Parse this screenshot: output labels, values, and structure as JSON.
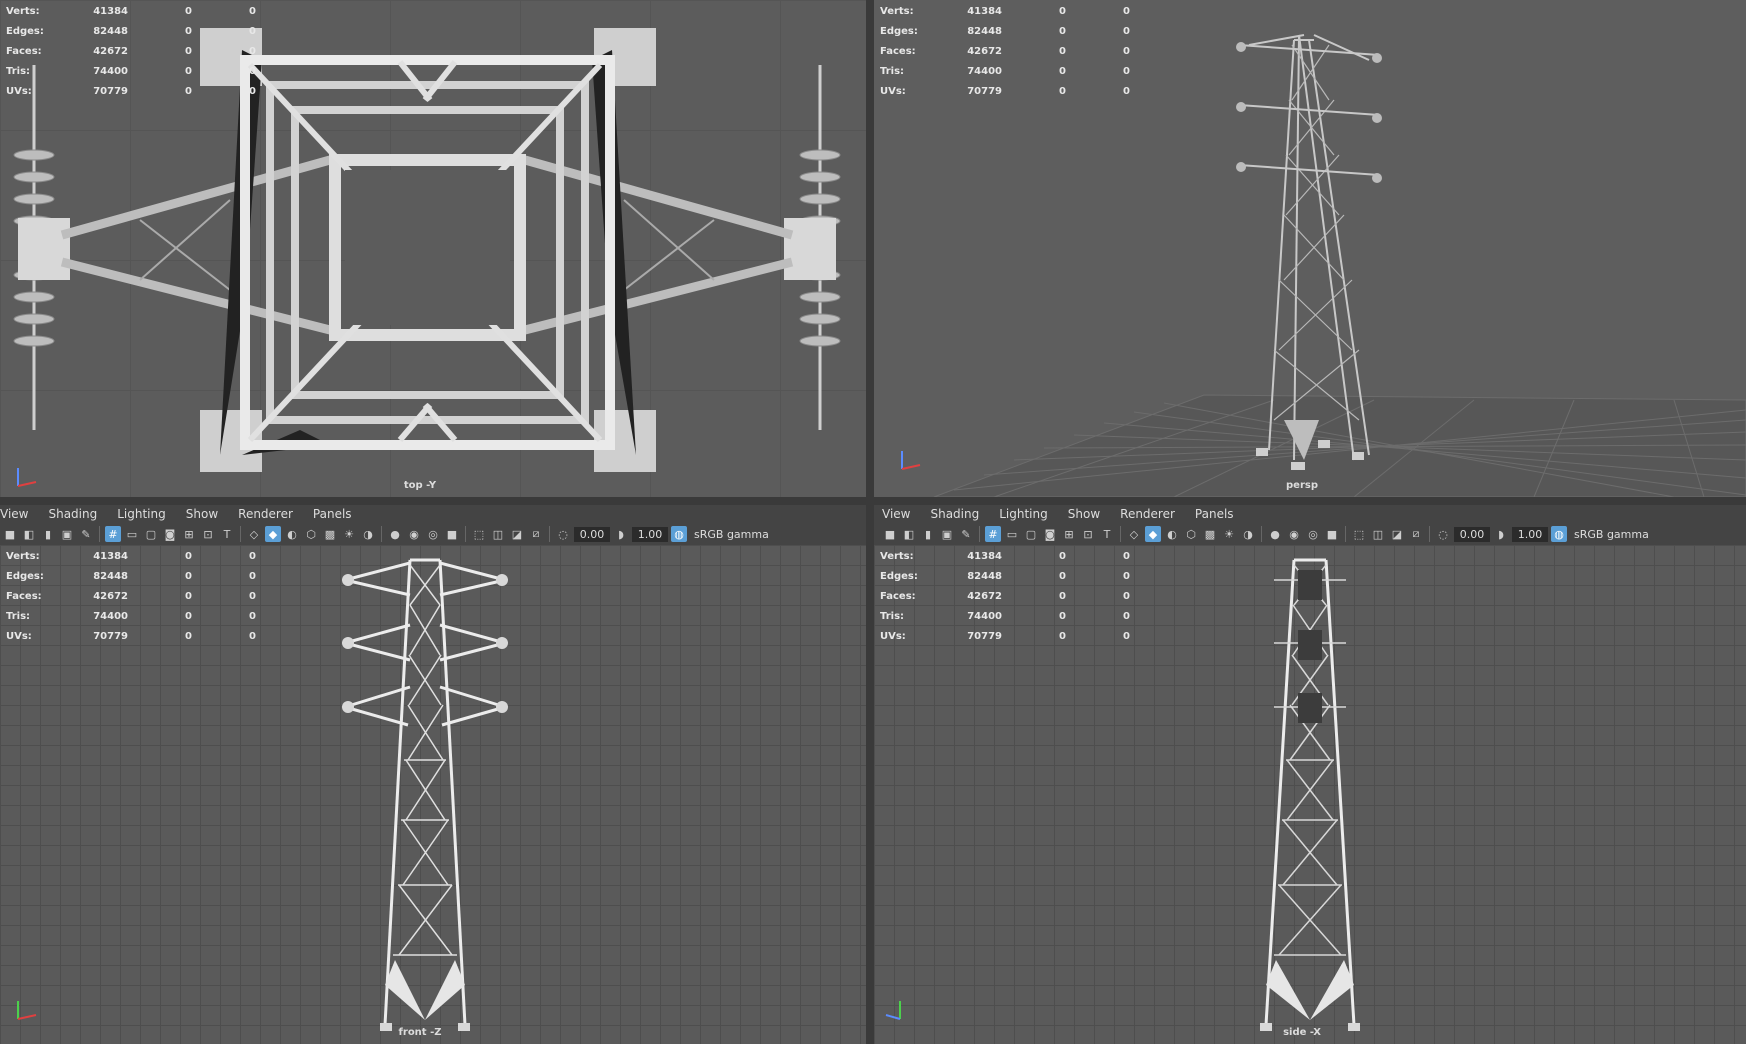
{
  "hud": {
    "rows": [
      {
        "label": "Verts:",
        "v1": "41384",
        "v2": "0",
        "v3": "0"
      },
      {
        "label": "Edges:",
        "v1": "82448",
        "v2": "0",
        "v3": "0"
      },
      {
        "label": "Faces:",
        "v1": "42672",
        "v2": "0",
        "v3": "0"
      },
      {
        "label": "Tris:",
        "v1": "74400",
        "v2": "0",
        "v3": "0"
      },
      {
        "label": "UVs:",
        "v1": "70779",
        "v2": "0",
        "v3": "0"
      }
    ]
  },
  "viewports": {
    "top": {
      "camera": "top -Y"
    },
    "persp": {
      "camera": "persp"
    },
    "front": {
      "camera": "front -Z"
    },
    "side": {
      "camera": "side -X"
    }
  },
  "panel_menu": {
    "view": "View",
    "shading": "Shading",
    "lighting": "Lighting",
    "show": "Show",
    "renderer": "Renderer",
    "panels": "Panels"
  },
  "toolbar": {
    "exposure": "0.00",
    "gamma_value": "1.00",
    "color_space": "sRGB gamma"
  },
  "colors": {
    "accent": "#5b9fd6",
    "viewport_bg": "#5a5a5a",
    "grid": "#4e4e4e"
  }
}
